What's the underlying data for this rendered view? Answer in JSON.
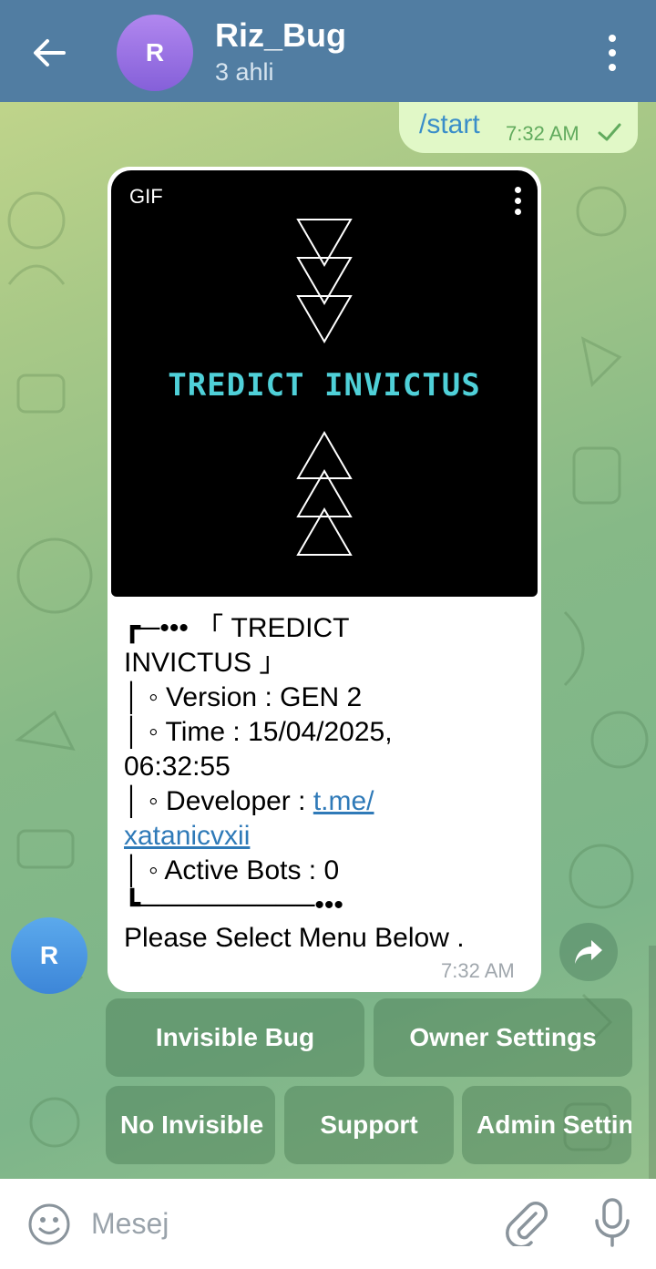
{
  "header": {
    "avatar_letter": "R",
    "title": "Riz_Bug",
    "subtitle": "3 ahli"
  },
  "outgoing": {
    "text": "/start",
    "time": "7:32 AM",
    "status_icon": "check-icon"
  },
  "incoming": {
    "gif_label": "GIF",
    "gif_title": "TREDICT INVICTUS",
    "lines": [
      "┏─••• 「 TREDICT",
      "INVICTUS 」",
      "│ ◦ Version : GEN 2",
      "│ ◦ Time : 15/04/2025,",
      "06:32:55",
      "│ ◦ Developer : ",
      "│ ◦ Active Bots : 0",
      "┗─────────•••"
    ],
    "developer_link_1": "t.me/",
    "developer_link_2": "xatanicvxii",
    "footer": "Please Select Menu Below .",
    "time": "7:32 AM",
    "sender_avatar_letter": "R"
  },
  "keyboard": {
    "row1": [
      "Invisible Bug",
      "Owner Settings"
    ],
    "row2": [
      "No Invisible",
      "Support",
      "Admin Settings"
    ]
  },
  "input": {
    "placeholder": "Mesej"
  },
  "colors": {
    "header_bg": "#517da2",
    "outgoing_bubble": "#e1f8c7",
    "link": "#2f7ab8",
    "gif_text": "#4fd0d8"
  }
}
